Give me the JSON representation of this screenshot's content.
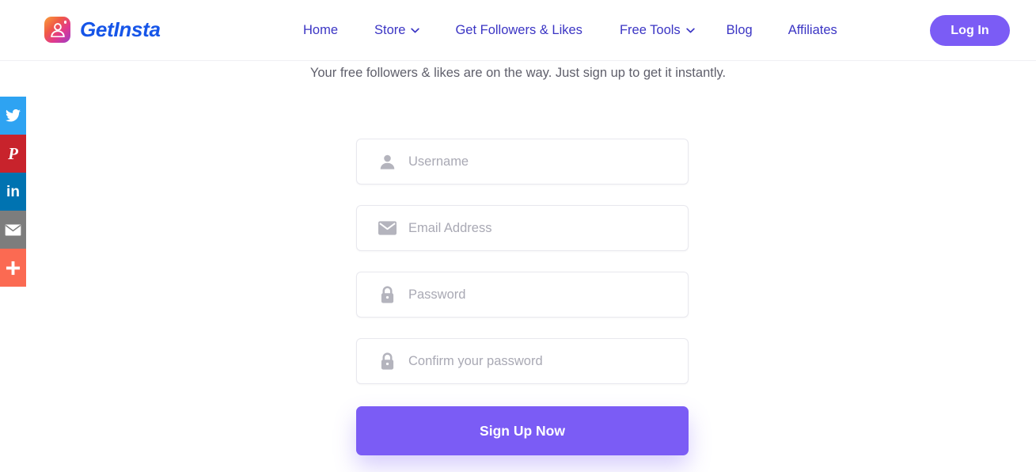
{
  "header": {
    "brand": {
      "name": "GetInsta",
      "logo_icon": "instagram-person-icon",
      "logo_colors": [
        "#f9a03b",
        "#f05a45",
        "#e0398e",
        "#9b3dc7"
      ],
      "name_color": "#1655e8"
    },
    "nav": [
      {
        "label": "Home",
        "has_dropdown": false,
        "icon": null
      },
      {
        "label": "Store",
        "has_dropdown": true,
        "icon": "chevron-down-icon"
      },
      {
        "label": "Get Followers & Likes",
        "has_dropdown": false,
        "icon": null
      },
      {
        "label": "Free Tools",
        "has_dropdown": true,
        "icon": "chevron-down-icon"
      },
      {
        "label": "Blog",
        "has_dropdown": false,
        "icon": null
      },
      {
        "label": "Affiliates",
        "has_dropdown": false,
        "icon": null
      }
    ],
    "nav_color": "#3b35c4",
    "login_label": "Log In",
    "login_color": "#7b5cf5"
  },
  "social_rail": [
    {
      "name": "twitter",
      "icon": "twitter-bird-icon",
      "color": "#2ea3f2"
    },
    {
      "name": "pinterest",
      "icon": "pinterest-p-icon",
      "color": "#c8232c",
      "glyph": "P"
    },
    {
      "name": "linkedin",
      "icon": "linkedin-in-icon",
      "color": "#0073b1",
      "glyph": "in"
    },
    {
      "name": "email",
      "icon": "envelope-icon",
      "color": "#7d7d7d"
    },
    {
      "name": "more",
      "icon": "plus-icon",
      "color": "#fb6a52"
    }
  ],
  "main": {
    "subtitle": "Your free followers & likes are on the way. Just sign up to get it instantly.",
    "fields": [
      {
        "name": "username",
        "placeholder": "Username",
        "value": "",
        "icon": "user-icon",
        "type": "text"
      },
      {
        "name": "email",
        "placeholder": "Email Address",
        "value": "",
        "icon": "envelope-icon",
        "type": "text"
      },
      {
        "name": "password",
        "placeholder": "Password",
        "value": "",
        "icon": "lock-icon",
        "type": "password"
      },
      {
        "name": "confirm-password",
        "placeholder": "Confirm your password",
        "value": "",
        "icon": "lock-icon",
        "type": "password"
      }
    ],
    "submit_label": "Sign Up Now",
    "submit_color": "#7b5cf5"
  }
}
